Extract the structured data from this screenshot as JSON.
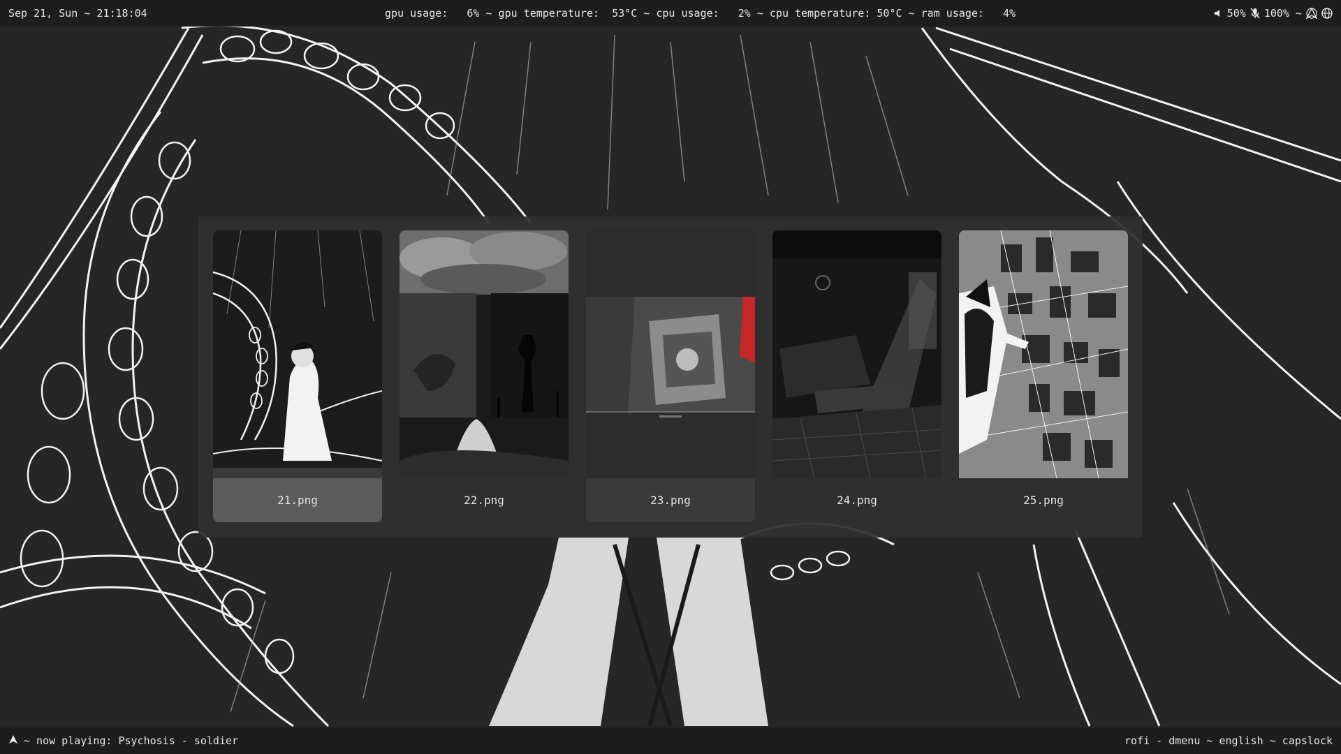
{
  "topbar": {
    "datetime": "Sep 21, Sun ~ 21:18:04",
    "stats": "gpu usage:   6% ~ gpu temperature:  53°C ~ cpu usage:   2% ~ cpu temperature: 50°C ~ ram usage:   4%",
    "volume": "50%",
    "mic": "100% ~",
    "volume_icon": "speaker-icon",
    "mic_icon": "mic-muted-icon",
    "arch_icon": "arch-logo-icon",
    "network_icon": "globe-icon"
  },
  "picker": {
    "selected_index": 0,
    "items": [
      {
        "label": "21.png",
        "state": "selected"
      },
      {
        "label": "22.png",
        "state": "normal"
      },
      {
        "label": "23.png",
        "state": "hovered"
      },
      {
        "label": "24.png",
        "state": "normal"
      },
      {
        "label": "25.png",
        "state": "normal"
      }
    ]
  },
  "bottombar": {
    "launcher_icon": "arch-logo-icon",
    "now_playing": "~ now playing: Psychosis - soldier",
    "status": "rofi - dmenu ~ english ~ capslock"
  },
  "colors": {
    "bar_bg": "#1d1d1d",
    "wallpaper_bg": "#262626",
    "picker_bg": "#303030",
    "selected_bg": "#5b5b5b",
    "text": "#e6e6e6"
  }
}
